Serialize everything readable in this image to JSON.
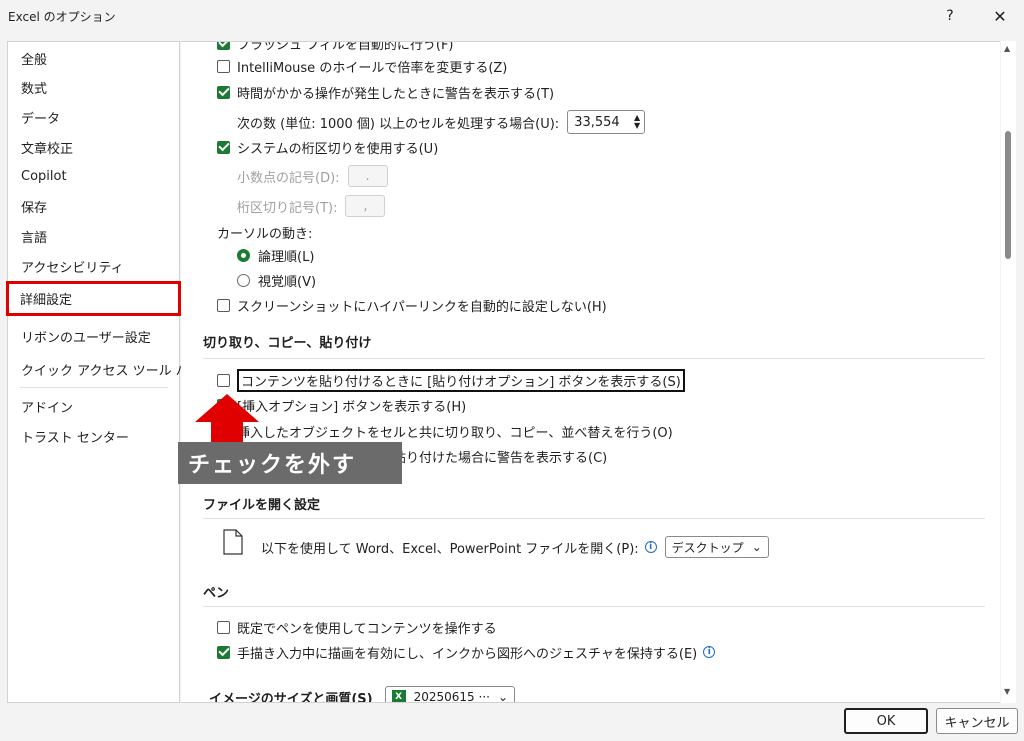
{
  "window": {
    "title": "Excel のオプション",
    "help": "?",
    "close": "✕"
  },
  "sidebar": {
    "items": [
      {
        "label": "全般"
      },
      {
        "label": "数式"
      },
      {
        "label": "データ"
      },
      {
        "label": "文章校正"
      },
      {
        "label": "Copilot"
      },
      {
        "label": "保存"
      },
      {
        "label": "言語"
      },
      {
        "label": "アクセシビリティ"
      },
      {
        "label": "詳細設定",
        "selected": true
      },
      {
        "label": "リボンのユーザー設定"
      },
      {
        "label": "クイック アクセス ツール バー"
      },
      {
        "label": "アドイン"
      },
      {
        "label": "トラスト センター"
      }
    ]
  },
  "editing": {
    "flash_fill": "フラッシュ フィルを自動的に行う(F)",
    "intellimouse": "IntelliMouse のホイールで倍率を変更する(Z)",
    "warn_long_ops": "時間がかかる操作が発生したときに警告を表示する(T)",
    "cells_threshold_label": "次の数 (単位: 1000 個) 以上のセルを処理する場合(U):",
    "cells_threshold_value": "33,554",
    "use_system_separators": "システムの桁区切りを使用する(U)",
    "decimal_sep_label": "小数点の記号(D):",
    "decimal_sep_value": ".",
    "thousands_sep_label": "桁区切り記号(T):",
    "thousands_sep_value": ",",
    "cursor_movement_label": "カーソルの動き:",
    "cursor_logical": "論理順(L)",
    "cursor_visual": "視覚順(V)",
    "no_hyperlink_screenshot": "スクリーンショットにハイパーリンクを自動的に設定しない(H)"
  },
  "cut_copy_paste": {
    "header": "切り取り、コピー、貼り付け",
    "show_paste_options": "コンテンツを貼り付けるときに [貼り付けオプション] ボタンを表示する(S)",
    "show_insert_options": "[挿入オプション] ボタンを表示する(H)",
    "cut_copy_sort_objects": "挿入したオブジェクトをセルと共に切り取り、コピー、並べ替えを行う(O)",
    "warn_external_data": "外部リンクを含むデータを貼り付けた場合に警告を表示する(C)"
  },
  "file_open": {
    "header": "ファイルを開く設定",
    "open_with_label": "以下を使用して Word、Excel、PowerPoint ファイルを開く(P):",
    "open_with_value": "デスクトップ"
  },
  "pen": {
    "header": "ペン",
    "use_pen": "既定でペンを使用してコンテンツを操作する",
    "ink_to_shape": "手描き入力中に描画を有効にし、インクから図形へのジェスチャを保持する(E)"
  },
  "image": {
    "header": "イメージのサイズと画質(S)",
    "file_value": "20250615 ···"
  },
  "buttons": {
    "ok": "OK",
    "cancel": "キャンセル"
  },
  "annotation": {
    "text": "チェックを外す"
  },
  "colors": {
    "accent": "#1d7a34",
    "highlight": "#e00000",
    "arrow": "#e00000",
    "annotation_bg": "#6b6b6b"
  }
}
